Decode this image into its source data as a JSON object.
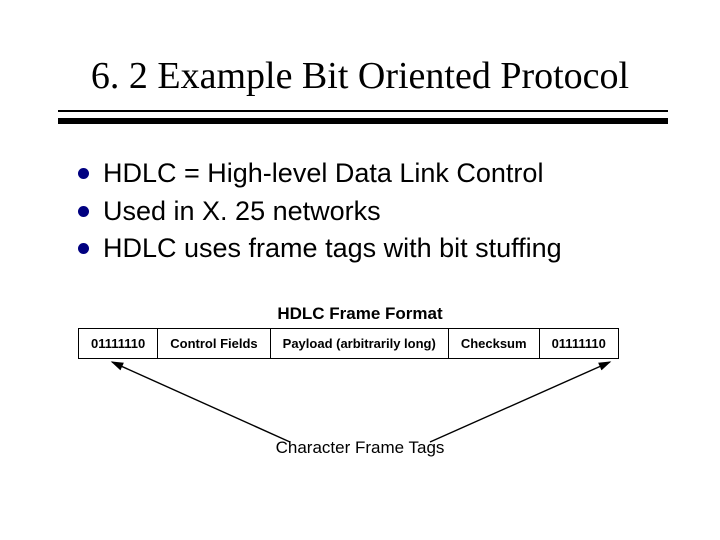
{
  "title": "6. 2 Example Bit Oriented Protocol",
  "bullets": [
    "HDLC = High-level Data Link Control",
    "Used in X. 25 networks",
    "HDLC uses frame tags with bit stuffing"
  ],
  "frame": {
    "title": "HDLC Frame Format",
    "cells": [
      "01111110",
      "Control Fields",
      "Payload (arbitrarily long)",
      "Checksum",
      "01111110"
    ],
    "caption": "Character Frame Tags"
  }
}
